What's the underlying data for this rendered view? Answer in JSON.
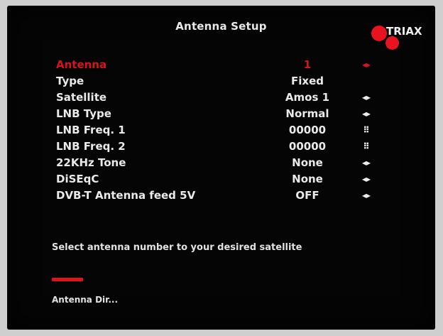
{
  "title": "Antenna Setup",
  "brand": {
    "name": "TRIAX",
    "color": "#e8131e"
  },
  "rows": [
    {
      "label": "Antenna",
      "value": "1",
      "control": "◂▸",
      "control_icon": "left-right-arrows-icon"
    },
    {
      "label": "Type",
      "value": "Fixed",
      "control": "",
      "control_icon": ""
    },
    {
      "label": "Satellite",
      "value": "Amos 1",
      "control": "◂▸",
      "control_icon": "left-right-arrows-icon"
    },
    {
      "label": "LNB Type",
      "value": "Normal",
      "control": "◂▸",
      "control_icon": "left-right-arrows-icon"
    },
    {
      "label": "LNB Freq. 1",
      "value": "00000",
      "control": "⠿",
      "control_icon": "numeric-keypad-icon"
    },
    {
      "label": "LNB Freq. 2",
      "value": "00000",
      "control": "⠿",
      "control_icon": "numeric-keypad-icon"
    },
    {
      "label": "22KHz Tone",
      "value": "None",
      "control": "◂▸",
      "control_icon": "left-right-arrows-icon"
    },
    {
      "label": "DiSEqC",
      "value": "None",
      "control": "◂▸",
      "control_icon": "left-right-arrows-icon"
    },
    {
      "label": "DVB-T Antenna feed 5V",
      "value": "OFF",
      "control": "◂▸",
      "control_icon": "left-right-arrows-icon"
    }
  ],
  "hint": "Select antenna number to your desired satellite",
  "footer": {
    "red_key_label": "Antenna Dir..."
  },
  "colors": {
    "highlight": "#d4141e",
    "text": "#eaeaea",
    "background": "#050505"
  }
}
